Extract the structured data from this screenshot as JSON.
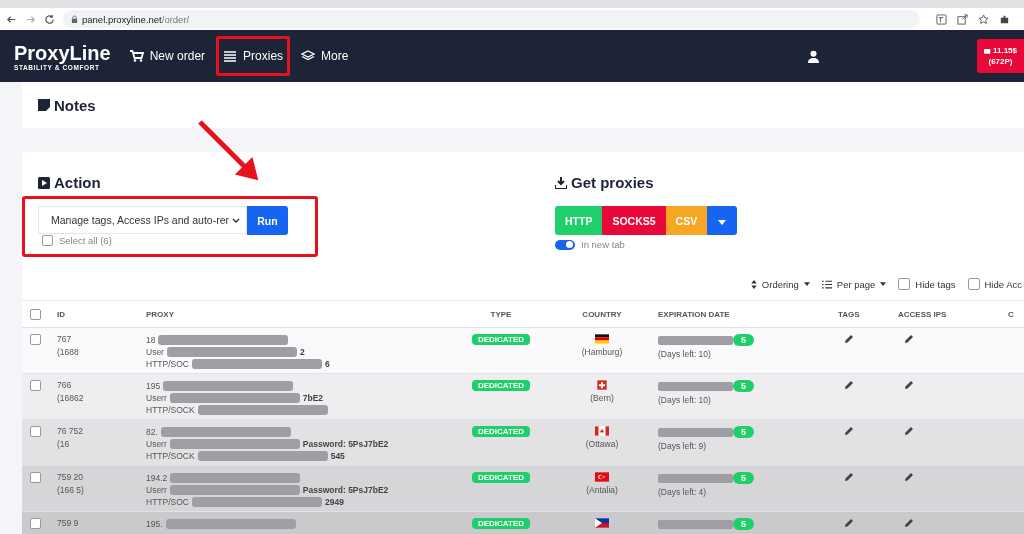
{
  "browser": {
    "url_host": "panel.proxyline.net",
    "url_path": "/order/"
  },
  "navbar": {
    "logo": "ProxyLine",
    "tagline": "STABILITY & COMFORT",
    "items": [
      {
        "label": "New order",
        "kind": "cart",
        "selected": false
      },
      {
        "label": "Proxies",
        "kind": "list",
        "selected": true
      },
      {
        "label": "More",
        "kind": "layers",
        "selected": false
      }
    ],
    "balance": [
      "11.15$",
      "(672P)"
    ]
  },
  "notes": {
    "title": "Notes"
  },
  "action": {
    "title": "Action",
    "select_value": "Manage tags, Access IPs and auto-rer",
    "run": "Run",
    "select_all": {
      "label": "Select all (6)",
      "checked": false
    }
  },
  "get_proxies": {
    "title": "Get proxies",
    "buttons": [
      {
        "label": "HTTP",
        "color": "#1fcf6a"
      },
      {
        "label": "SOCKS5",
        "color": "#e8093a"
      },
      {
        "label": "CSV",
        "color": "#f5a623"
      }
    ],
    "new_tab": {
      "label": "In new tab",
      "on": true
    }
  },
  "toolbar": {
    "ordering": "Ordering",
    "per_page": "Per page",
    "filters": [
      {
        "label": "Hide tags",
        "checked": false
      },
      {
        "label": "Hide Acc",
        "checked": false
      }
    ]
  },
  "table": {
    "columns": [
      "ID",
      "PROXY",
      "TYPE",
      "COUNTRY",
      "EXPIRATION DATE",
      "TAGS",
      "ACCESS IPS",
      "C"
    ],
    "header_checked": false,
    "rows": [
      {
        "checked": false,
        "id": [
          "767",
          "(1688"
        ],
        "proxy": [
          {
            "text": "18"
          },
          {
            "text": "User",
            "tail": "2"
          },
          {
            "text": "HTTP/SOC",
            "tail": "6"
          }
        ],
        "type": "DEDICATED",
        "kind": "de",
        "city": "(Hamburg)",
        "days": "(Days left: 10)",
        "count": "5"
      },
      {
        "checked": false,
        "id": [
          "766",
          "(16862"
        ],
        "proxy": [
          {
            "text": "195"
          },
          {
            "text": "Userr",
            "tail": "7bE2"
          },
          {
            "text": "HTTP/SOCK"
          }
        ],
        "type": "DEDICATED",
        "kind": "ch",
        "city": "(Bern)",
        "days": "(Days left: 10)",
        "count": "5"
      },
      {
        "checked": false,
        "id": [
          "76 752",
          "(16"
        ],
        "proxy": [
          {
            "text": "82."
          },
          {
            "text": "Userr",
            "tail": "Password: 5PsJ7bE2"
          },
          {
            "text": "HTTP/SOCK",
            "tail": "545"
          }
        ],
        "type": "DEDICATED",
        "kind": "ca",
        "city": "(Ottawa)",
        "days": "(Days left: 9)",
        "count": "5"
      },
      {
        "checked": false,
        "id": [
          "759 20",
          "(166 5)"
        ],
        "proxy": [
          {
            "text": "194.2"
          },
          {
            "text": "Userr",
            "tail": "Password: 5PsJ7bE2"
          },
          {
            "text": "HTTP/SOC",
            "tail": "2949"
          }
        ],
        "type": "DEDICATED",
        "kind": "tr",
        "city": "(Antalia)",
        "days": "(Days left: 4)",
        "count": "5"
      },
      {
        "checked": false,
        "id": [
          "759 9"
        ],
        "proxy": [
          {
            "text": "195."
          }
        ],
        "type": "DEDICATED",
        "kind": "ph",
        "count": "5"
      }
    ]
  }
}
